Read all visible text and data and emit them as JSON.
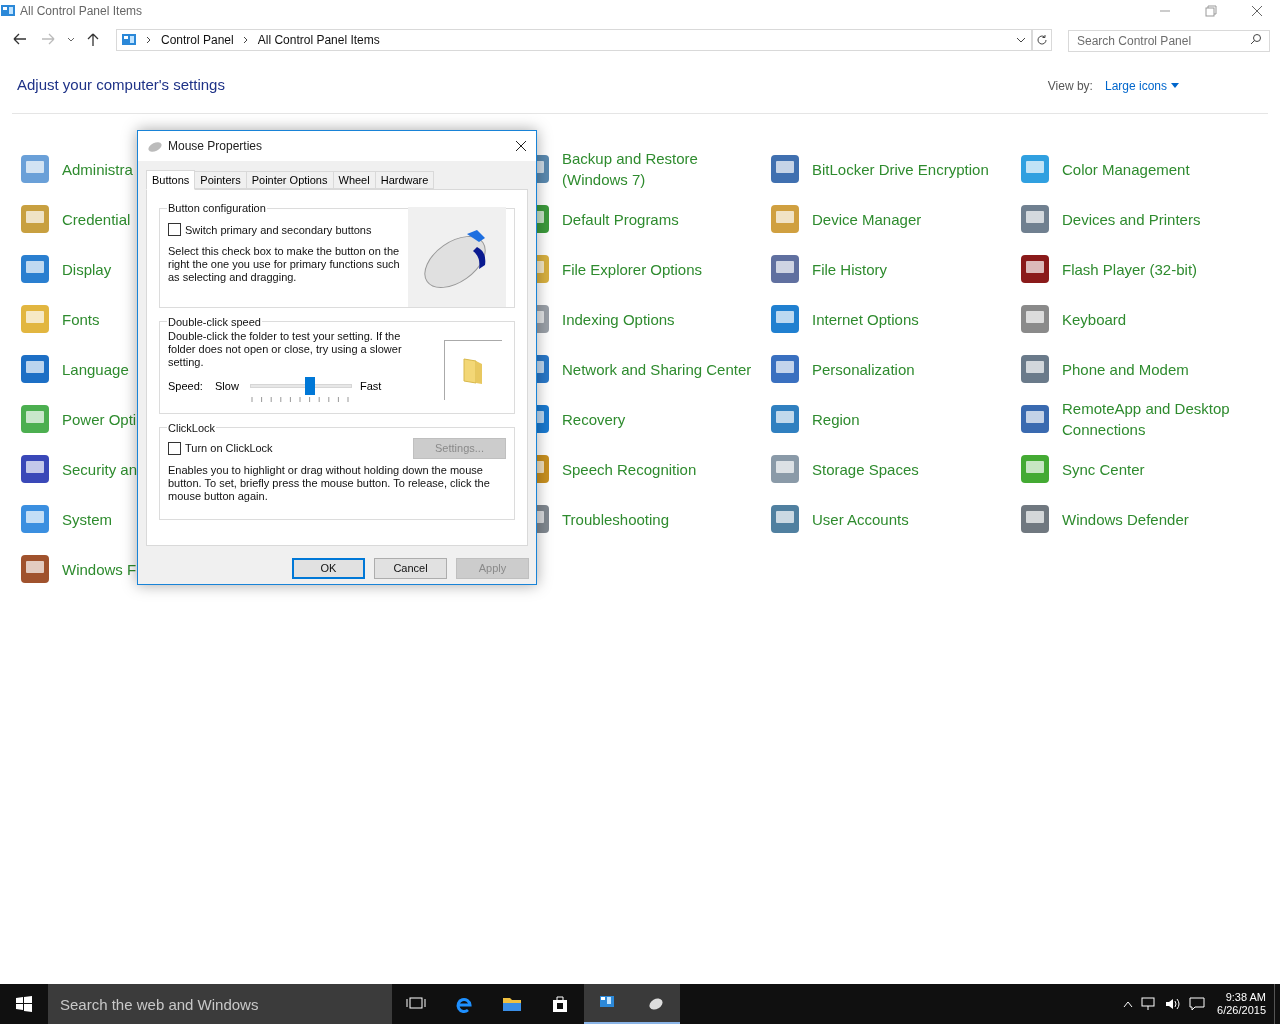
{
  "window": {
    "title": "All Control Panel Items"
  },
  "address": {
    "crumbs": [
      "Control Panel",
      "All Control Panel Items"
    ]
  },
  "search": {
    "placeholder": "Search Control Panel"
  },
  "heading": "Adjust your computer's settings",
  "view_by": {
    "label": "View by:",
    "value": "Large icons"
  },
  "columns": [
    [
      "Administra",
      "Credential",
      "Display",
      "Fonts",
      "Language",
      "Power Opti",
      "Security an",
      "System",
      "Windows F"
    ],
    [],
    [
      "Backup and Restore (Windows 7)",
      "Default Programs",
      "File Explorer Options",
      "Indexing Options",
      "Network and Sharing Center",
      "Recovery",
      "Speech Recognition",
      "Troubleshooting"
    ],
    [
      "BitLocker Drive Encryption",
      "Device Manager",
      "File History",
      "Internet Options",
      "Personalization",
      "Region",
      "Storage Spaces",
      "User Accounts"
    ],
    [
      "Color Management",
      "Devices and Printers",
      "Flash Player (32-bit)",
      "Keyboard",
      "Phone and Modem",
      "RemoteApp and Desktop Connections",
      "Sync Center",
      "Windows Defender"
    ]
  ],
  "dialog": {
    "title": "Mouse Properties",
    "tabs": [
      {
        "label": "Buttons",
        "selected": true
      },
      {
        "label": "Pointers",
        "selected": false
      },
      {
        "label": "Pointer Options",
        "selected": false
      },
      {
        "label": "Wheel",
        "selected": false
      },
      {
        "label": "Hardware",
        "selected": false
      }
    ],
    "button_configuration": {
      "legend": "Button configuration",
      "checkbox": {
        "label": "Switch primary and secondary buttons",
        "checked": false
      },
      "description": "Select this check box to make the button on the right the one you use for primary functions such as selecting and dragging."
    },
    "double_click_speed": {
      "legend": "Double-click speed",
      "description": "Double-click the folder to test your setting. If the folder does not open or close, try using a slower setting.",
      "speed_label": "Speed:",
      "min_label": "Slow",
      "max_label": "Fast",
      "level": 0.59
    },
    "clicklock": {
      "legend": "ClickLock",
      "checkbox": {
        "label": "Turn on ClickLock",
        "checked": false
      },
      "settings_button": {
        "label": "Settings...",
        "disabled": true
      },
      "description": "Enables you to highlight or drag without holding down the mouse button. To set, briefly press the mouse button. To release, click the mouse button again."
    },
    "buttons": [
      {
        "label": "OK",
        "default": true,
        "disabled": false
      },
      {
        "label": "Cancel",
        "default": false,
        "disabled": false
      },
      {
        "label": "Apply",
        "default": false,
        "disabled": true
      }
    ]
  },
  "taskbar": {
    "search_placeholder": "Search the web and Windows",
    "apps": [
      {
        "kind": "taskview",
        "active": false
      },
      {
        "kind": "edge",
        "active": false
      },
      {
        "kind": "explorer",
        "active": false
      },
      {
        "kind": "store",
        "active": false
      },
      {
        "kind": "controlpanel",
        "active": true
      },
      {
        "kind": "mouse",
        "active": true
      }
    ],
    "time": "9:38 AM",
    "date": "6/26/2015"
  }
}
